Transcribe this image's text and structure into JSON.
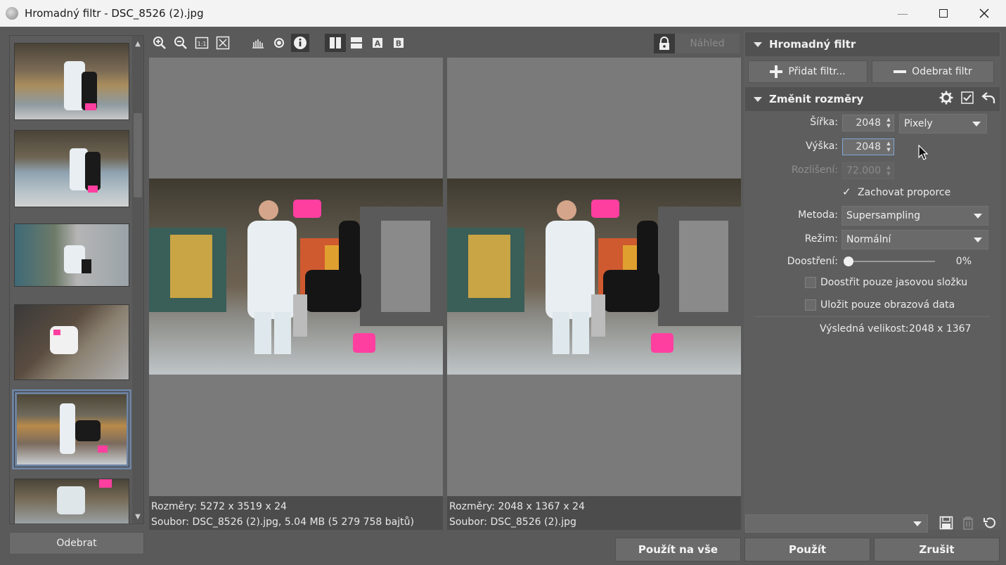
{
  "window": {
    "title": "Hromadný filtr - DSC_8526 (2).jpg"
  },
  "thumbnails": {
    "remove_label": "Odebrat",
    "count": 6,
    "selected_index": 4
  },
  "toolbar": {
    "preview_label": "Náhled"
  },
  "preview": {
    "original_dims": "Rozměry: 5272 x 3519 x 24",
    "original_file": "Soubor: DSC_8526 (2).jpg, 5.04 MB (5 279 758 bajtů)",
    "result_dims": "Rozměry: 2048 x 1367 x 24",
    "result_file": "Soubor: DSC_8526 (2).jpg"
  },
  "panel": {
    "header": "Hromadný filtr",
    "add_filter": "Přidat filtr...",
    "remove_filter": "Odebrat filtr",
    "filter_title": "Změnit rozměry",
    "width_label": "Šířka:",
    "width_value": "2048",
    "unit": "Pixely",
    "height_label": "Výška:",
    "height_value": "2048",
    "resolution_label": "Rozlišení:",
    "resolution_value": "72.000",
    "keep_ratio_label": "Zachovat proporce",
    "keep_ratio_checked": true,
    "method_label": "Metoda:",
    "method_value": "Supersampling",
    "mode_label": "Režim:",
    "mode_value": "Normální",
    "sharpen_label": "Doostření:",
    "sharpen_value": "0%",
    "sharpen_luma_label": "Doostřit pouze jasovou složku",
    "save_image_only_label": "Uložit pouze obrazová data",
    "result_size_label": "Výsledná velikost:",
    "result_size_value": "2048 x 1367"
  },
  "actions": {
    "apply_all": "Použít na vše",
    "apply": "Použít",
    "cancel": "Zrušit"
  }
}
